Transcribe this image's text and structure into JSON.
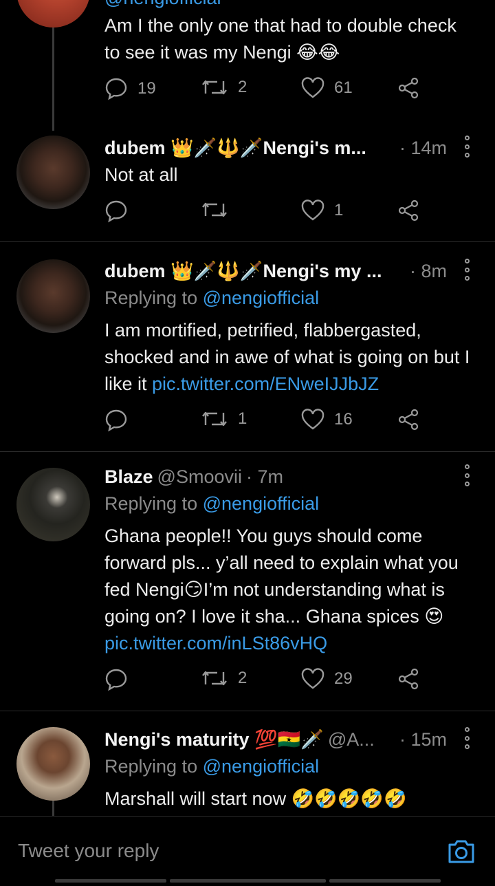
{
  "tweets": [
    {
      "body": "Am I the only one that had to double check to see it was my Nengi 😂😂",
      "replies": "19",
      "retweets": "2",
      "likes": "61"
    },
    {
      "name": "dubem 👑🗡️🔱🗡️Nengi's m...",
      "time": "· 14m",
      "body": "Not at all",
      "replies": "",
      "retweets": "",
      "likes": "1"
    },
    {
      "name": "dubem 👑🗡️🔱🗡️Nengi's my ...",
      "time": "· 8m",
      "replying_prefix": "Replying to",
      "replying_handle": "@nengiofficial",
      "body": "I am mortified, petrified, flabbergasted, shocked and in awe of what is going on but I like it",
      "link": "pic.twitter.com/ENweIJJbJZ",
      "replies": "",
      "retweets": "1",
      "likes": "16"
    },
    {
      "name": "Blaze",
      "handle": "@Smoovii",
      "time": "· 7m",
      "replying_prefix": "Replying to",
      "replying_handle": "@nengiofficial",
      "body": "Ghana people!! You guys should come forward pls... y’all need to explain what you fed Nengi😏I’m not understanding what is going on? I love it sha... Ghana spices 😍",
      "link": "pic.twitter.com/inLSt86vHQ",
      "replies": "",
      "retweets": "2",
      "likes": "29"
    },
    {
      "name": "Nengi's maturity 💯🇬🇭🗡️",
      "handle": "@A...",
      "time": "· 15m",
      "replying_prefix": "Replying to",
      "replying_handle": "@nengiofficial",
      "body": "Marshall will start now 🤣🤣🤣🤣🤣"
    }
  ],
  "compose": {
    "placeholder": "Tweet your reply"
  },
  "icons": {
    "reply": "speech-bubble-icon",
    "retweet": "retweet-icon",
    "like": "heart-icon",
    "share": "share-icon",
    "more": "more-vertical-icon",
    "camera": "camera-icon"
  },
  "colors": {
    "link": "#3a9be6",
    "background": "#000000",
    "muted": "#8b8b8b"
  }
}
